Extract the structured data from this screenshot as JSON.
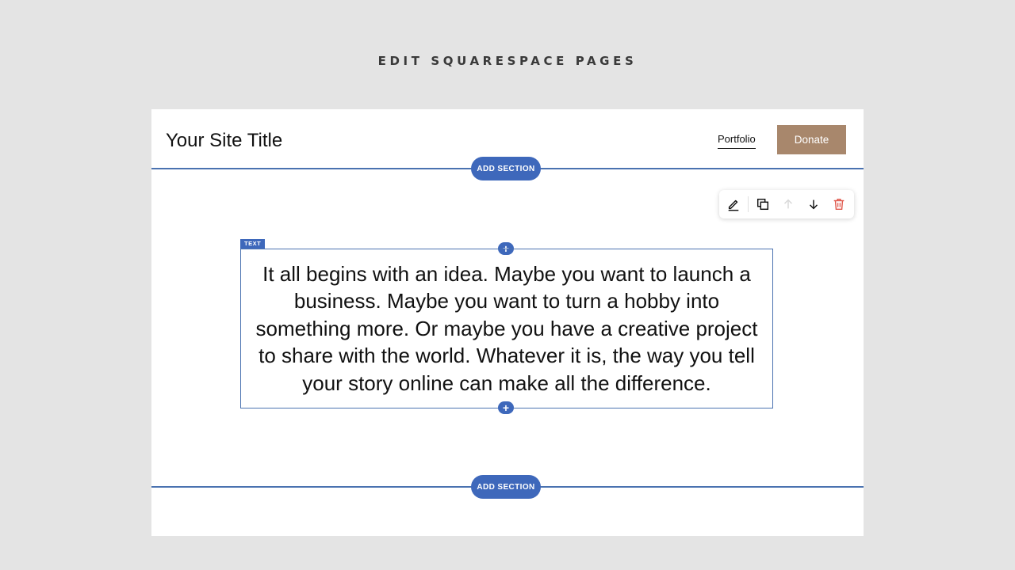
{
  "page": {
    "heading": "EDIT SQUARESPACE PAGES"
  },
  "site": {
    "title": "Your Site Title",
    "nav_link": "Portfolio",
    "donate_label": "Donate"
  },
  "sections": {
    "add_section_label": "ADD SECTION"
  },
  "block": {
    "tag": "TEXT",
    "text": "It all begins with an idea. Maybe you want to launch a business. Maybe you want to turn a hobby into something more. Or maybe you have a creative project to share with the world. Whatever it is, the way you tell your story online can make all the difference."
  },
  "toolbar": {
    "icons": [
      "edit-pencil-icon",
      "duplicate-icon",
      "move-up-arrow-icon",
      "move-down-arrow-icon",
      "trash-icon"
    ]
  },
  "colors": {
    "accent": "#3e68bb",
    "donate_button": "#a8876c",
    "delete": "#e0594d"
  }
}
